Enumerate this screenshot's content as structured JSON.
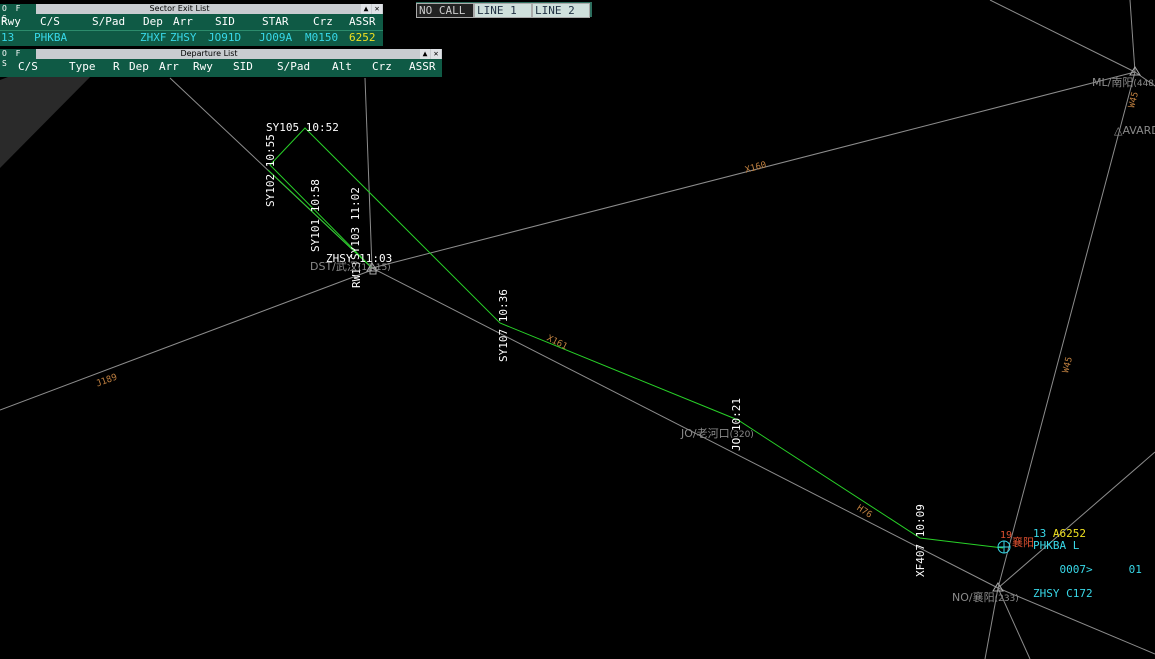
{
  "sector_exit_list": {
    "title": "Sector Exit List",
    "tabs": "O F S",
    "columns": [
      "Rwy",
      "C/S",
      "S/Pad",
      "Dep",
      "Arr",
      "SID",
      "STAR",
      "Crz",
      "ASSR"
    ],
    "row": {
      "rwy": "13",
      "cs": "PHKBA",
      "spad": "",
      "dep": "ZHXF",
      "arr": "ZHSY",
      "sid": "JO91D",
      "star": "JO09A",
      "crz": "M0150",
      "assr": "6252"
    }
  },
  "departure_list": {
    "title": "Departure List",
    "tabs": "O F S",
    "columns": [
      "C/S",
      "Type",
      "R",
      "Dep",
      "Arr",
      "Rwy",
      "SID",
      "S/Pad",
      "Alt",
      "Crz",
      "ASSR"
    ]
  },
  "call_bar": {
    "no_call": "NO CALL",
    "line1": "LINE 1",
    "line2": "LINE 2"
  },
  "route_points": [
    {
      "name": "SY105",
      "time": "10:52"
    },
    {
      "name": "SY102",
      "time": "10:55"
    },
    {
      "name": "SY101",
      "time": "10:58"
    },
    {
      "name": "SY103",
      "time": "11:02"
    },
    {
      "name": "ZHSY",
      "time": "11:03"
    },
    {
      "name": "RW13",
      "time": ""
    },
    {
      "name": "SY107",
      "time": "10:36"
    },
    {
      "name": "JO",
      "time": "10:21"
    },
    {
      "name": "XF407",
      "time": "10:09"
    }
  ],
  "fixes": {
    "dst": "DST/武汉",
    "dst_suffix": "(13.15)",
    "jo": "JO/老河口",
    "jo_suffix": "(320)",
    "no": "NO/襄阳",
    "no_suffix": "(233)",
    "ml": "ML/南阳",
    "ml_suffix": "(448)",
    "avard": "AVARD",
    "xf_city": "襄阳"
  },
  "airways": [
    "X160",
    "X161",
    "H76",
    "J189",
    "W45",
    "W45"
  ],
  "track": {
    "line1_rwy": "13",
    "line1_ssr": "A6252",
    "callsign": "PHKBA L",
    "level": "0007>",
    "speed": "01",
    "dest": "ZHSY C172",
    "leader": "19"
  },
  "colors": {
    "panel": "#0f5a45",
    "route": "#28d028",
    "airway": "#9a9a9a",
    "label_cyan": "#38d8e8",
    "ssr_yellow": "#f0e020",
    "airway_label": "#c08040"
  }
}
